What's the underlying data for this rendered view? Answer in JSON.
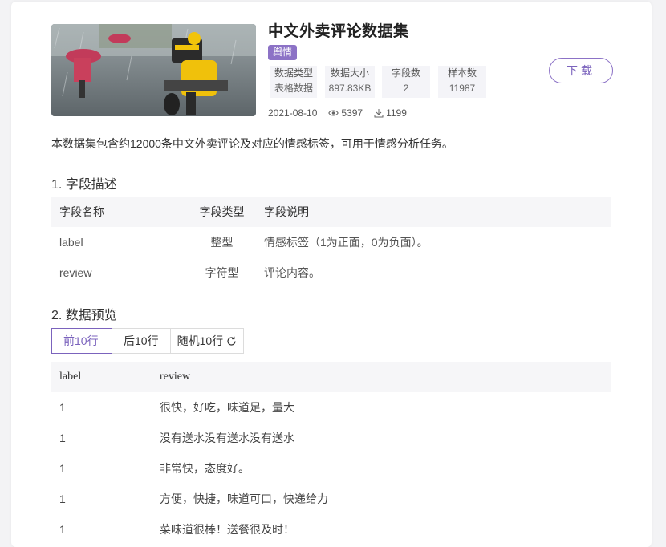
{
  "dataset": {
    "title": "中文外卖评论数据集",
    "tag": "舆情",
    "meta": [
      {
        "label": "数据类型",
        "value": "表格数据"
      },
      {
        "label": "数据大小",
        "value": "897.83KB"
      },
      {
        "label": "字段数",
        "value": "2"
      },
      {
        "label": "样本数",
        "value": "11987"
      }
    ],
    "date": "2021-08-10",
    "views": "5397",
    "downloads": "1199",
    "download_label": "下载",
    "description": "本数据集包含约12000条中文外卖评论及对应的情感标签，可用于情感分析任务。"
  },
  "fields_section": {
    "heading": "1. 字段描述",
    "headers": [
      "字段名称",
      "字段类型",
      "字段说明"
    ],
    "rows": [
      {
        "name": "label",
        "type": "整型",
        "desc": "情感标签（1为正面，0为负面）。"
      },
      {
        "name": "review",
        "type": "字符型",
        "desc": "评论内容。"
      }
    ]
  },
  "preview_section": {
    "heading": "2. 数据预览",
    "tabs": [
      "前10行",
      "后10行",
      "随机10行"
    ],
    "headers": [
      "label",
      "review"
    ],
    "rows": [
      {
        "label": "1",
        "review": "很快，好吃，味道足，量大"
      },
      {
        "label": "1",
        "review": "没有送水没有送水没有送水"
      },
      {
        "label": "1",
        "review": "非常快，态度好。"
      },
      {
        "label": "1",
        "review": "方便，快捷，味道可口，快递给力"
      },
      {
        "label": "1",
        "review": "菜味道很棒！送餐很及时！"
      }
    ]
  },
  "colors": {
    "accent": "#7b63bd",
    "tag_bg": "#8c72c6"
  },
  "icons": {
    "views": "eye-icon",
    "downloads": "download-icon",
    "refresh": "refresh-icon"
  }
}
